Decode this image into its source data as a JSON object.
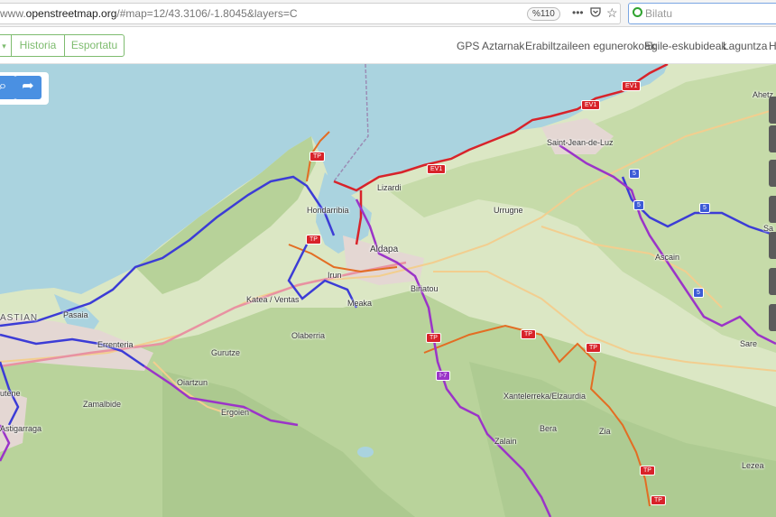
{
  "browser": {
    "url_prefix": "www.",
    "url_domain": "openstreetmap.org",
    "url_rest": "/#map=12/43.3106/-1.8045&layers=C",
    "zoom": "%110",
    "menu_icon": "ellipsis-icon",
    "pocket_icon": "pocket-icon",
    "bookmark_icon": "star-icon",
    "search_placeholder": "Bilatu"
  },
  "header": {
    "buttons": [
      "Historia",
      "Esportatu"
    ],
    "nav": [
      "GPS Aztarnak",
      "Erabiltzaileen egunerokoak",
      "Egile-eskubideak",
      "Laguntza",
      "H"
    ]
  },
  "map": {
    "colors": {
      "water": "#aad3df",
      "land": "#dbe7c4",
      "forest": "#b2cf95",
      "cycle_red": "#d8232a",
      "cycle_blue": "#3c3cd6",
      "cycle_purple": "#9b34c8",
      "cycle_orange": "#e36d23",
      "road": "#f2ce8f"
    },
    "places": [
      "Hondarribia",
      "Lizardi",
      "Urrugne",
      "Saint-Jean-de-Luz",
      "Aldapa",
      "Irun",
      "Katea / Ventas",
      "Meaka",
      "Biriatou",
      "Ascain",
      "Ahetz",
      "Pasaia",
      "ASTIAN",
      "Errenteria",
      "Olaberria",
      "Gurutze",
      "Oiartzun",
      "Ergoien",
      "Zamalbide",
      "utene",
      "Astigarraga",
      "Xantelerreka/Elzaurdia",
      "Bera",
      "Zia",
      "Zalain",
      "Sare",
      "Lezea",
      "Sa"
    ],
    "shields": {
      "tp": "TP",
      "ev1": "EV1",
      "five": "5",
      "i7": "I-7"
    }
  }
}
